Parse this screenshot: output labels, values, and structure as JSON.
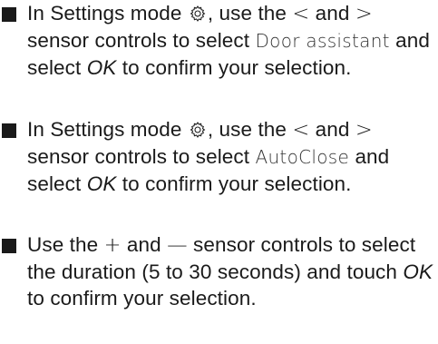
{
  "instructions": [
    {
      "p1": "In Settings mode ",
      "icon": "gear-icon",
      "p2": ", use the ",
      "sym1": "<",
      "p3": " and ",
      "sym2": ">",
      "p4": " sensor controls to select ",
      "option": "Door assistant",
      "p5": " and select ",
      "ok": "OK",
      "p6": " to confirm your selection."
    },
    {
      "p1": "In Settings mode ",
      "icon": "gear-icon",
      "p2": ", use the ",
      "sym1": "<",
      "p3": " and ",
      "sym2": ">",
      "p4": " sensor controls to select ",
      "option": "AutoClose",
      "p5": " and select ",
      "ok": "OK",
      "p6": " to confirm your selection."
    },
    {
      "p1": "Use the ",
      "sym1": "+",
      "p2": " and ",
      "sym2": "—",
      "p3": " sensor controls to select the duration (5 to 30 seconds) and touch ",
      "ok": "OK",
      "p4": " to confirm your selection."
    }
  ]
}
